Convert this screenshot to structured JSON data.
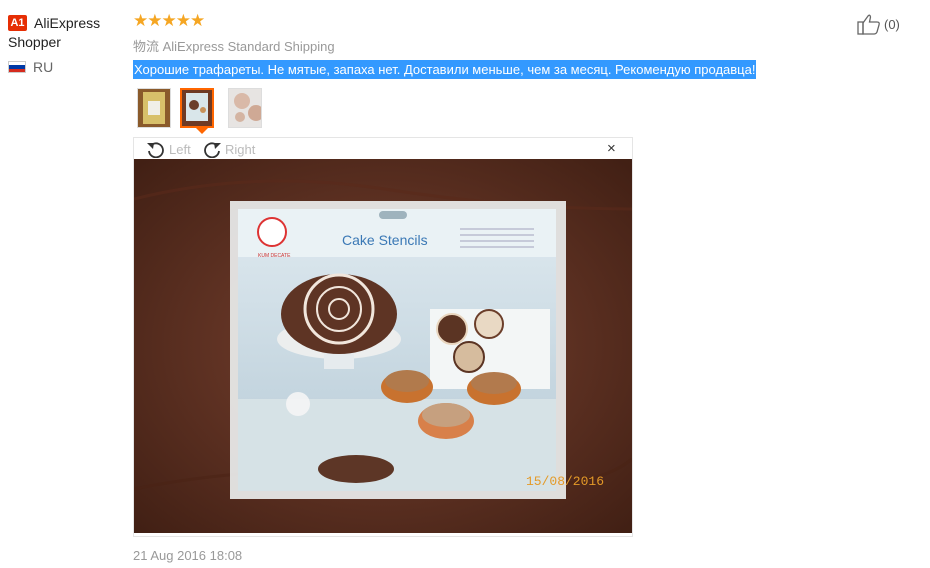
{
  "user": {
    "badge": "A1",
    "name_line1": "AliExpress",
    "name_line2": "Shopper",
    "country": "RU"
  },
  "review": {
    "rating": 5,
    "stars": "★★★★★",
    "shipping": "物流 AliExpress Standard Shipping",
    "text": "Хорошие трафареты. Не мятые, запаха нет. Доставили меньше, чем за месяц. Рекомендую продавца!",
    "date": "21 Aug 2016 18:08"
  },
  "viewer": {
    "left_label": "Left",
    "right_label": "Right",
    "close_glyph": "×"
  },
  "photo": {
    "package_title": "Cake Stencils",
    "brand_text": "KUM DECATE",
    "date_stamp": "15/08/2016"
  },
  "like": {
    "count": "(0)"
  },
  "colors": {
    "badge": "#e62e04",
    "star": "#f5a623",
    "highlight": "#3399ff",
    "active_thumb": "#ff6600"
  }
}
